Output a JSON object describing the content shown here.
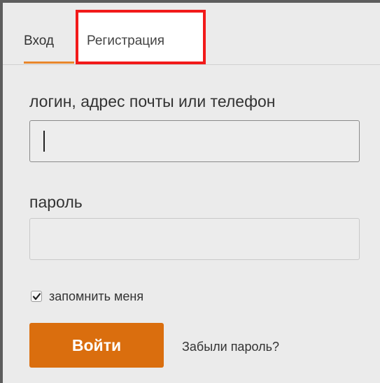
{
  "tabs": {
    "login_label": "Вход",
    "register_label": "Регистрация"
  },
  "form": {
    "login_label": "логин, адрес почты или телефон",
    "login_value": "",
    "password_label": "пароль",
    "password_value": "",
    "remember_label": "запомнить меня",
    "remember_checked": true,
    "submit_label": "Войти",
    "forgot_label": "Забыли пароль?"
  },
  "colors": {
    "accent": "#da6e0e",
    "tab_underline": "#e8872c",
    "highlight_box": "#f21a1a",
    "panel_bg": "#ebebeb"
  }
}
